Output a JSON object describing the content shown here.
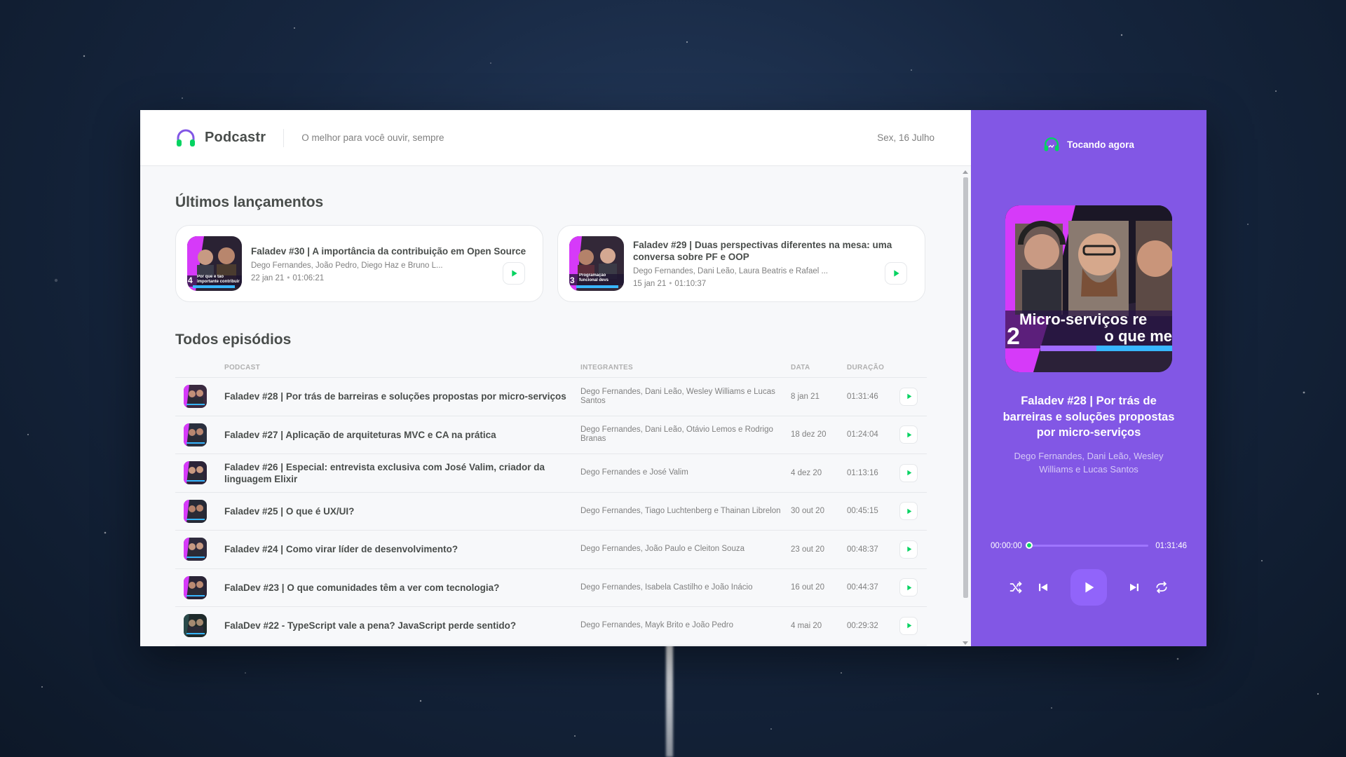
{
  "app": {
    "name": "Podcastr",
    "tagline": "O melhor para você ouvir, sempre",
    "date": "Sex, 16 Julho"
  },
  "latest": {
    "title": "Últimos lançamentos",
    "items": [
      {
        "title": "Faladev #30 | A importância da contribuição em Open Source",
        "members": "Dego Fernandes, João Pedro, Diego Haz e Bruno L...",
        "date": "22 jan 21",
        "duration": "01:06:21",
        "thumb_caption": "Por que é tão importante contribuir em Open S",
        "thumb_number": "4"
      },
      {
        "title": "Faladev #29 | Duas perspectivas diferentes na mesa: uma conversa sobre PF e OOP",
        "members": "Dego Fernandes, Dani Leão, Laura Beatris e Rafael ...",
        "date": "15 jan 21",
        "duration": "01:10:37",
        "thumb_caption": "Programação funcional devs orientados a o",
        "thumb_number": "3"
      }
    ]
  },
  "episodes": {
    "title": "Todos episódios",
    "columns": {
      "podcast": "Podcast",
      "members": "Integrantes",
      "date": "Data",
      "duration": "Duração"
    },
    "rows": [
      {
        "title": "Faladev #28 | Por trás de barreiras e soluções propostas por micro-serviços",
        "members": "Dego Fernandes, Dani Leão, Wesley Williams e Lucas Santos",
        "date": "8 jan 21",
        "duration": "01:31:46"
      },
      {
        "title": "Faladev #27 | Aplicação de arquiteturas MVC e CA na prática",
        "members": "Dego Fernandes, Dani Leão, Otávio Lemos e Rodrigo Branas",
        "date": "18 dez 20",
        "duration": "01:24:04"
      },
      {
        "title": "Faladev #26 | Especial: entrevista exclusiva com José Valim, criador da linguagem Elixir",
        "members": "Dego Fernandes e José Valim",
        "date": "4 dez 20",
        "duration": "01:13:16"
      },
      {
        "title": "Faladev #25 | O que é UX/UI?",
        "members": "Dego Fernandes, Tiago Luchtenberg e Thainan Librelon",
        "date": "30 out 20",
        "duration": "00:45:15"
      },
      {
        "title": "Faladev #24 | Como virar líder de desenvolvimento?",
        "members": "Dego Fernandes, João Paulo e Cleiton Souza",
        "date": "23 out 20",
        "duration": "00:48:37"
      },
      {
        "title": "FalaDev #23 | O que comunidades têm a ver com tecnologia?",
        "members": "Dego Fernandes, Isabela Castilho e João Inácio",
        "date": "16 out 20",
        "duration": "00:44:37"
      },
      {
        "title": "FalaDev #22 - TypeScript vale a pena? JavaScript perde sentido?",
        "members": "Dego Fernandes, Mayk Brito e João Pedro",
        "date": "4 mai 20",
        "duration": "00:29:32"
      }
    ]
  },
  "player": {
    "header": "Tocando agora",
    "cover_text_line1": "Micro-serviços re",
    "cover_text_line2": "o que me",
    "cover_number": "2",
    "title": "Faladev #28 | Por trás de barreiras e soluções propostas por micro-serviços",
    "members": "Dego Fernandes, Dani Leão, Wesley Williams e Lucas Santos",
    "current_time": "00:00:00",
    "total_time": "01:31:46",
    "progress": 0
  },
  "colors": {
    "brand_purple": "#8257e5",
    "play_green": "#04d361",
    "text_dark": "#494d4b",
    "text_muted": "#808080"
  },
  "icons": [
    "headphones-icon",
    "play-icon",
    "shuffle-icon",
    "previous-icon",
    "next-icon",
    "repeat-icon"
  ]
}
